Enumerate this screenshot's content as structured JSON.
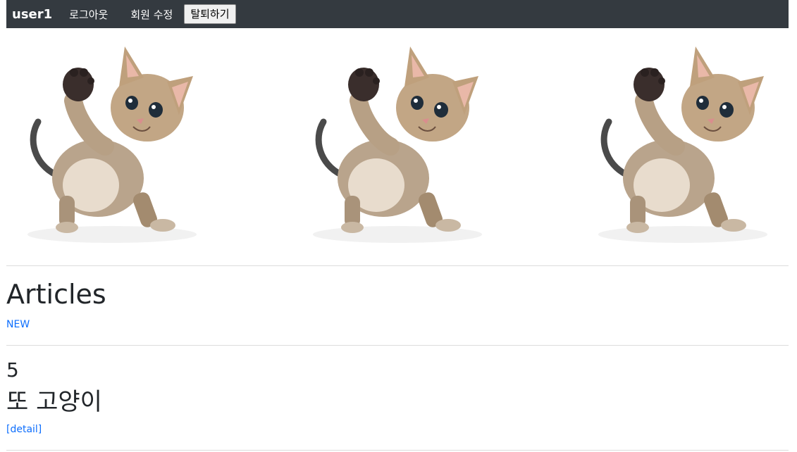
{
  "navbar": {
    "brand": "user1",
    "logout_label": "로그아웃",
    "edit_label": "회원 수정",
    "withdraw_label": "탈퇴하기"
  },
  "gallery": {
    "images": [
      {
        "alt": "kitten"
      },
      {
        "alt": "kitten"
      },
      {
        "alt": "kitten"
      }
    ]
  },
  "articles": {
    "heading": "Articles",
    "new_label": "NEW",
    "items": [
      {
        "id": "5",
        "title": "또 고양이",
        "detail_label": "[detail]"
      }
    ]
  }
}
